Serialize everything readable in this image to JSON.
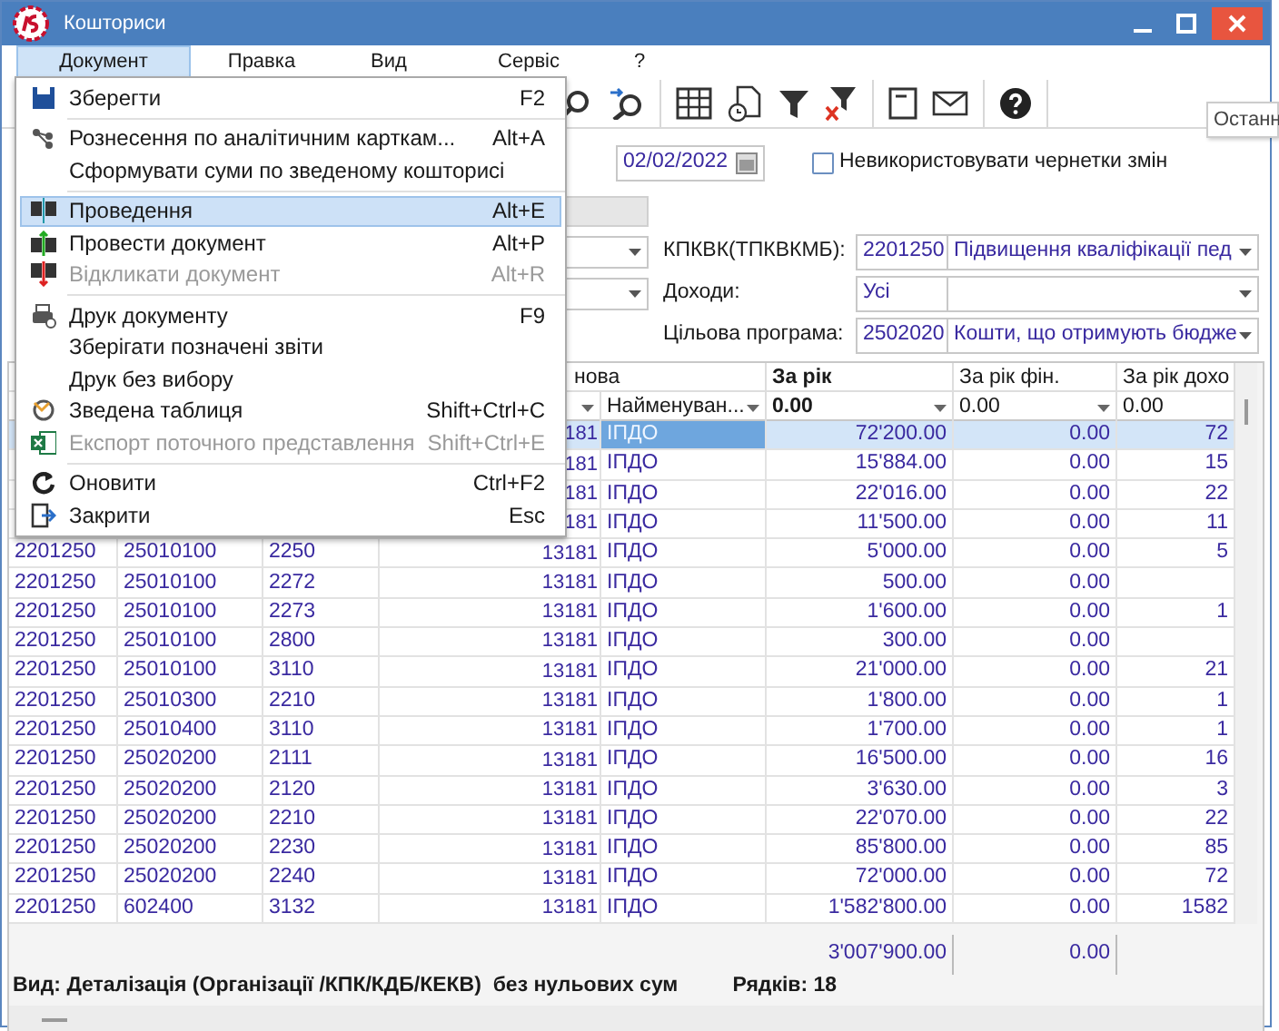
{
  "window": {
    "title": "Кошториси"
  },
  "menu_bar": [
    {
      "label": "Документ",
      "selected": true
    },
    {
      "label": "Правка",
      "selected": false
    },
    {
      "label": "Вид",
      "selected": false
    },
    {
      "label": "Сервіс",
      "selected": false
    },
    {
      "label": "?",
      "selected": false
    }
  ],
  "menu": {
    "groups": [
      [
        {
          "kind": "save",
          "label": "Зберегти",
          "shortcut": "F2",
          "disabled": false,
          "selected": false
        }
      ],
      [
        {
          "kind": "distribute",
          "label": "Рознесення по аналітичним карткам...",
          "shortcut": "Alt+A",
          "disabled": false,
          "selected": false
        },
        {
          "kind": "none",
          "label": "Сформувати суми по зведеному кошторисі",
          "disabled": false,
          "selected": false
        }
      ],
      [
        {
          "kind": "dk",
          "label": "Проведення",
          "shortcut": "Alt+E",
          "disabled": false,
          "selected": true
        },
        {
          "kind": "dk_post",
          "label": "Провести документ",
          "shortcut": "Alt+P",
          "disabled": false,
          "selected": false
        },
        {
          "kind": "dk_revoke",
          "label": "Відкликати документ",
          "shortcut": "Alt+R",
          "disabled": true,
          "selected": false
        }
      ],
      [
        {
          "kind": "print",
          "label": "Друк документу",
          "shortcut": "F9",
          "disabled": false,
          "selected": false
        },
        {
          "kind": "none",
          "label": "Зберігати позначені звіти",
          "disabled": false,
          "selected": false
        },
        {
          "kind": "none",
          "label": "Друк без вибору",
          "disabled": false,
          "selected": false
        },
        {
          "kind": "pivot",
          "label": "Зведена таблиця",
          "shortcut": "Shift+Ctrl+C",
          "disabled": false,
          "selected": false
        },
        {
          "kind": "excel",
          "label": "Експорт поточного представлення",
          "shortcut": "Shift+Ctrl+E",
          "disabled": true,
          "selected": false
        }
      ],
      [
        {
          "kind": "refresh",
          "label": "Оновити",
          "shortcut": "Ctrl+F2",
          "disabled": false,
          "selected": false
        },
        {
          "kind": "exit",
          "label": "Закрити",
          "shortcut": "Esc",
          "disabled": false,
          "selected": false
        }
      ]
    ]
  },
  "tooltip": "Останн",
  "form": {
    "date": "02/02/2022",
    "no_drafts": {
      "label": "Невикористовувати чернетки змін",
      "checked": false
    },
    "fields": [
      {
        "label": "КПКВК(ТПКВКМБ):",
        "code": "2201250",
        "name": "Підвищення кваліфікації пед"
      },
      {
        "label": "Доходи:",
        "code": "Усі"
      },
      {
        "label": "Цільова програма:",
        "code": "2502020",
        "name": "Кошти, що отримують бюдже"
      }
    ]
  },
  "table": {
    "group_header": "нова",
    "columns": [
      {
        "label": "За рік",
        "bold": true
      },
      {
        "label": "За рік фін.",
        "bold": false
      },
      {
        "label": "За рік дохо",
        "bold": false
      }
    ],
    "filters": [
      {
        "text": "Найменуван...",
        "bold": false
      },
      {
        "text": "0.00",
        "bold": true
      },
      {
        "text": "0.00",
        "bold": false
      },
      {
        "text": "0.00",
        "bold": false
      }
    ],
    "rows": [
      {
        "code": "181",
        "name": "ІПДО",
        "year": "72'200.00",
        "fin": "0.00",
        "income": "72",
        "selected": true
      },
      {
        "code": "181",
        "name": "ІПДО",
        "year": "15'884.00",
        "fin": "0.00",
        "income": "15",
        "selected": false
      },
      {
        "code": "181",
        "name": "ІПДО",
        "year": "22'016.00",
        "fin": "0.00",
        "income": "22",
        "selected": false
      },
      {
        "code": "181",
        "name": "ІПДО",
        "year": "11'500.00",
        "fin": "0.00",
        "income": "11",
        "selected": false
      },
      {
        "kpk": "2201250",
        "kdb": "25010100",
        "kekv": "2250",
        "code": "13181",
        "name": "ІПДО",
        "year": "5'000.00",
        "fin": "0.00",
        "income": "5",
        "selected": false
      },
      {
        "kpk": "2201250",
        "kdb": "25010100",
        "kekv": "2272",
        "code": "13181",
        "name": "ІПДО",
        "year": "500.00",
        "fin": "0.00",
        "selected": false
      },
      {
        "kpk": "2201250",
        "kdb": "25010100",
        "kekv": "2273",
        "code": "13181",
        "name": "ІПДО",
        "year": "1'600.00",
        "fin": "0.00",
        "income": "1",
        "selected": false
      },
      {
        "kpk": "2201250",
        "kdb": "25010100",
        "kekv": "2800",
        "code": "13181",
        "name": "ІПДО",
        "year": "300.00",
        "fin": "0.00",
        "selected": false
      },
      {
        "kpk": "2201250",
        "kdb": "25010100",
        "kekv": "3110",
        "code": "13181",
        "name": "ІПДО",
        "year": "21'000.00",
        "fin": "0.00",
        "income": "21",
        "selected": false
      },
      {
        "kpk": "2201250",
        "kdb": "25010300",
        "kekv": "2210",
        "code": "13181",
        "name": "ІПДО",
        "year": "1'800.00",
        "fin": "0.00",
        "income": "1",
        "selected": false
      },
      {
        "kpk": "2201250",
        "kdb": "25010400",
        "kekv": "3110",
        "code": "13181",
        "name": "ІПДО",
        "year": "1'700.00",
        "fin": "0.00",
        "income": "1",
        "selected": false
      },
      {
        "kpk": "2201250",
        "kdb": "25020200",
        "kekv": "2111",
        "code": "13181",
        "name": "ІПДО",
        "year": "16'500.00",
        "fin": "0.00",
        "income": "16",
        "selected": false
      },
      {
        "kpk": "2201250",
        "kdb": "25020200",
        "kekv": "2120",
        "code": "13181",
        "name": "ІПДО",
        "year": "3'630.00",
        "fin": "0.00",
        "income": "3",
        "selected": false
      },
      {
        "kpk": "2201250",
        "kdb": "25020200",
        "kekv": "2210",
        "code": "13181",
        "name": "ІПДО",
        "year": "22'070.00",
        "fin": "0.00",
        "income": "22",
        "selected": false
      },
      {
        "kpk": "2201250",
        "kdb": "25020200",
        "kekv": "2230",
        "code": "13181",
        "name": "ІПДО",
        "year": "85'800.00",
        "fin": "0.00",
        "income": "85",
        "selected": false
      },
      {
        "kpk": "2201250",
        "kdb": "25020200",
        "kekv": "2240",
        "code": "13181",
        "name": "ІПДО",
        "year": "72'000.00",
        "fin": "0.00",
        "income": "72",
        "selected": false
      },
      {
        "kpk": "2201250",
        "kdb": "602400",
        "kekv": "3132",
        "code": "13181",
        "name": "ІПДО",
        "year": "1'582'800.00",
        "fin": "0.00",
        "income": "1582",
        "selected": false
      }
    ],
    "totals": [
      "3'007'900.00",
      "0.00"
    ]
  },
  "status": {
    "view": "Вид: Деталізація (Організації /КПК/КДБ/КЕКВ)  без нульових сум",
    "rows": "Рядків: 18"
  }
}
